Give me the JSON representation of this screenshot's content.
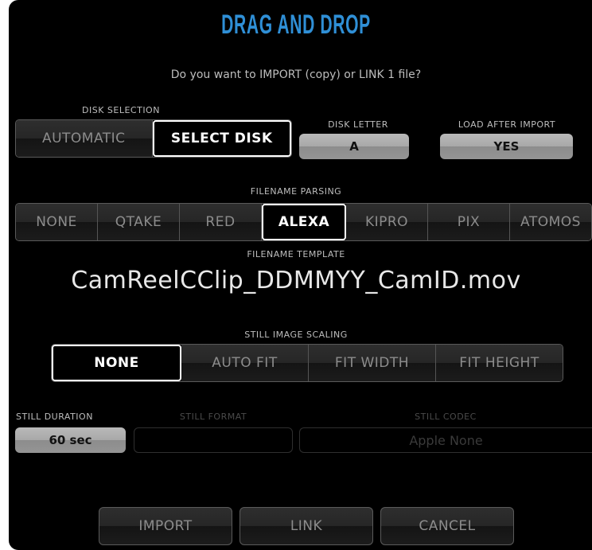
{
  "dialog": {
    "title": "DRAG AND DROP",
    "question": "Do you want to IMPORT (copy) or LINK 1 file?"
  },
  "disk_selection": {
    "label": "DISK SELECTION",
    "options": [
      "AUTOMATIC",
      "SELECT DISK"
    ],
    "selected": "SELECT DISK"
  },
  "disk_letter": {
    "label": "DISK LETTER",
    "value": "A"
  },
  "load_after_import": {
    "label": "LOAD AFTER IMPORT",
    "value": "YES"
  },
  "filename_parsing": {
    "label": "FILENAME PARSING",
    "options": [
      "NONE",
      "QTAKE",
      "RED",
      "ALEXA",
      "KIPRO",
      "PIX",
      "ATOMOS"
    ],
    "selected": "ALEXA"
  },
  "filename_template": {
    "label": "FILENAME TEMPLATE",
    "value": "CamReelCClip_DDMMYY_CamID.mov"
  },
  "still_image_scaling": {
    "label": "STILL IMAGE SCALING",
    "options": [
      "NONE",
      "AUTO FIT",
      "FIT WIDTH",
      "FIT HEIGHT"
    ],
    "selected": "NONE"
  },
  "still_duration": {
    "label": "STILL DURATION",
    "value": "60 sec"
  },
  "still_format": {
    "label": "STILL FORMAT",
    "value": ""
  },
  "still_codec": {
    "label": "STILL CODEC",
    "value": "Apple None"
  },
  "actions": {
    "import": "IMPORT",
    "link": "LINK",
    "cancel": "CANCEL"
  },
  "colors": {
    "title": "#2f8fd6",
    "background": "#000000",
    "selected_border": "#ffffff"
  }
}
